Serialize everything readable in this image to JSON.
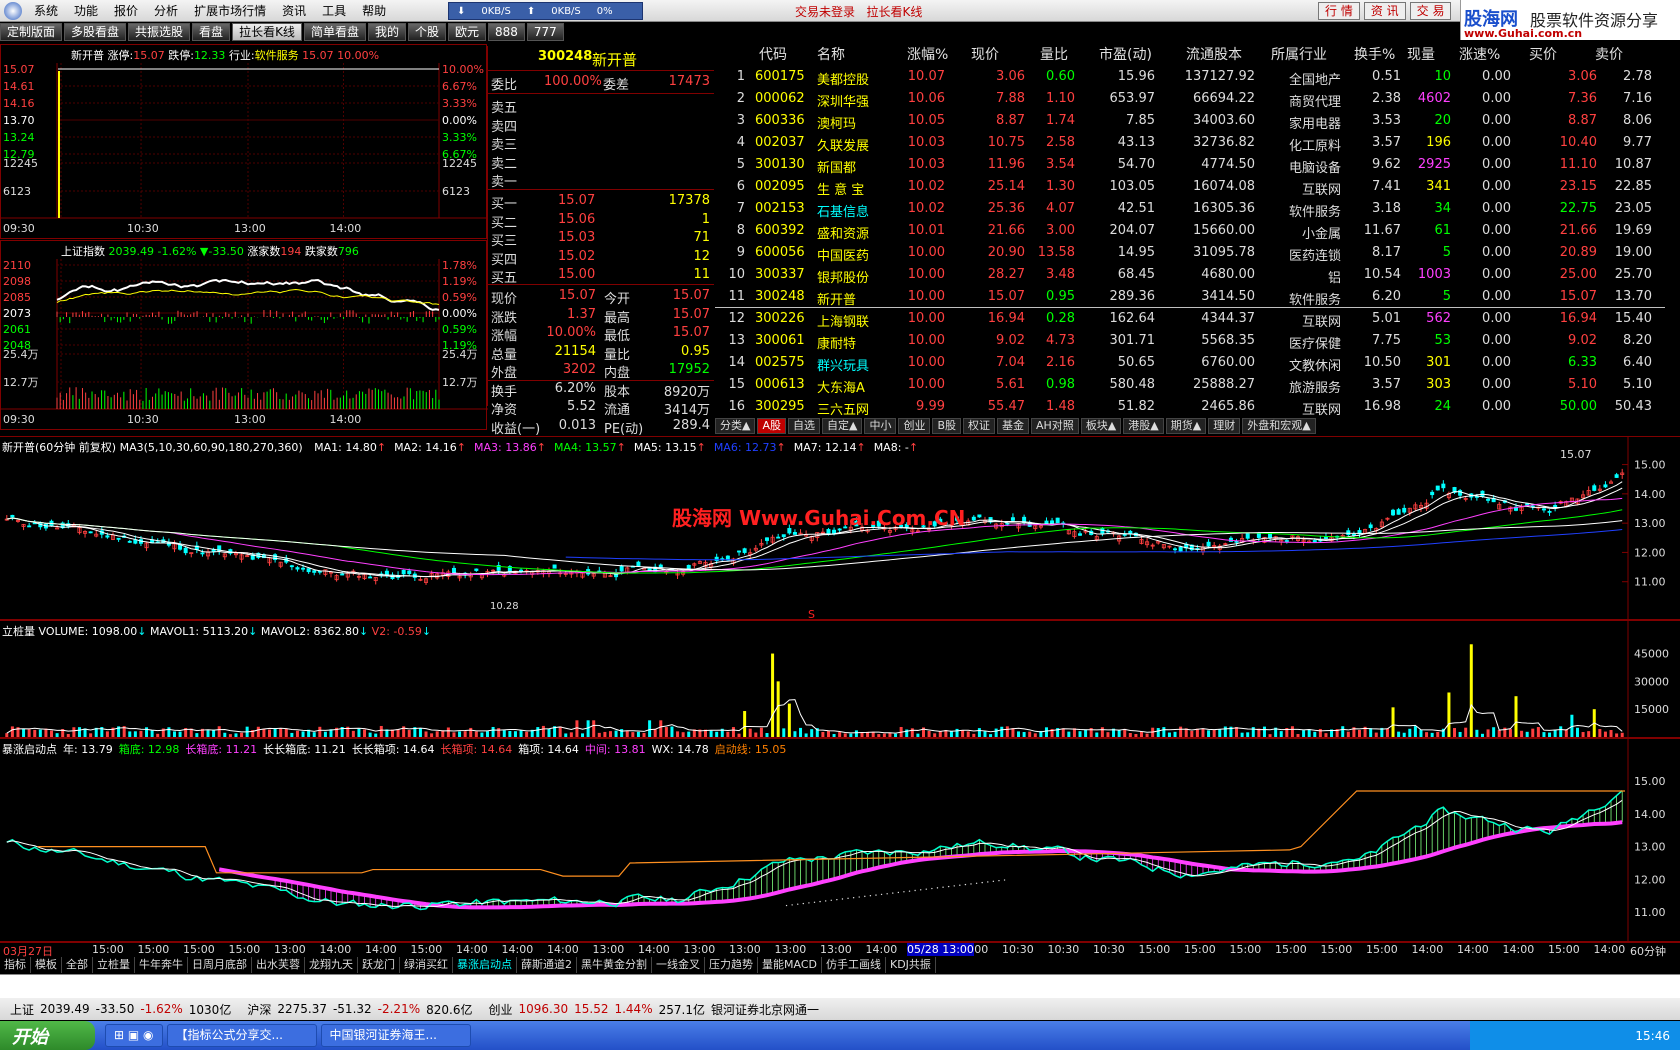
{
  "menu": [
    "系统",
    "功能",
    "报价",
    "分析",
    "扩展市场行情",
    "资讯",
    "工具",
    "帮助"
  ],
  "net": {
    "down": "0KB/S",
    "up": "0KB/S",
    "pct": "0%"
  },
  "login": "交易未登录",
  "login2": "拉长看K线",
  "topbtns": [
    "行 情",
    "资 讯",
    "交 易"
  ],
  "brand": {
    "name": "股海网",
    "slogan": "股票软件资源分享",
    "url": "www.Guhai.com.cn"
  },
  "tabs": [
    "定制版面",
    "多股看盘",
    "共振选股",
    "看盘",
    "拉长看K线",
    "简单看盘",
    "我的",
    "个股",
    "欧元",
    "888",
    "777"
  ],
  "mini1": {
    "title": "新开普",
    "zt_label": "涨停:",
    "zt": "15.07",
    "dt_label": "跌停:",
    "dt": "12.33",
    "ind_label": "行业:",
    "ind": "软件服务",
    "price": "15.07",
    "pct": "10.00%",
    "left_ticks": [
      "15.07",
      "14.61",
      "14.16",
      "13.70",
      "13.24",
      "12.79",
      "12245",
      "6123"
    ],
    "right_ticks": [
      "10.00%",
      "6.67%",
      "3.33%",
      "0.00%",
      "3.33%",
      "6.67%",
      "12245",
      "6123"
    ],
    "times": [
      "09:30",
      "10:30",
      "13:00",
      "14:00"
    ]
  },
  "mini2": {
    "title": "上证指数",
    "value": "2039.49",
    "pct": "-1.62%",
    "chg": "▼-33.50",
    "up_label": "涨家数",
    "up": "194",
    "down_label": "跌家数",
    "down": "796",
    "left_ticks": [
      "2110",
      "2098",
      "2085",
      "2073",
      "2061",
      "2048",
      "25.4万",
      "12.7万"
    ],
    "right_ticks": [
      "1.78%",
      "1.19%",
      "0.59%",
      "0.00%",
      "0.59%",
      "1.19%",
      "25.4万",
      "12.7万"
    ],
    "times": [
      "09:30",
      "10:30",
      "13:00",
      "14:00"
    ]
  },
  "book": {
    "code": "300248",
    "name": "新开普",
    "wb_label": "委比",
    "wb": "100.00%",
    "wc_label": "委差",
    "wc": "17473",
    "sells": [
      "卖五",
      "卖四",
      "卖三",
      "卖二",
      "卖一"
    ],
    "buys": [
      {
        "l": "买一",
        "p": "15.07",
        "v": "17378"
      },
      {
        "l": "买二",
        "p": "15.06",
        "v": "1"
      },
      {
        "l": "买三",
        "p": "15.03",
        "v": "71"
      },
      {
        "l": "买四",
        "p": "15.02",
        "v": "12"
      },
      {
        "l": "买五",
        "p": "15.00",
        "v": "11"
      }
    ],
    "stats": [
      [
        "现价",
        "15.07",
        "今开",
        "15.07"
      ],
      [
        "涨跌",
        "1.37",
        "最高",
        "15.07"
      ],
      [
        "涨幅",
        "10.00%",
        "最低",
        "15.07"
      ],
      [
        "总量",
        "21154",
        "量比",
        "0.95"
      ],
      [
        "外盘",
        "3202",
        "内盘",
        "17952"
      ],
      [
        "换手",
        "6.20%",
        "股本",
        "8920万"
      ],
      [
        "净资",
        "5.52",
        "流通",
        "3414万"
      ],
      [
        "收益(一)",
        "0.013",
        "PE(动)",
        "289.4"
      ]
    ]
  },
  "table": {
    "headers": [
      "代码",
      "名称",
      "涨幅%",
      "现价",
      "量比",
      "市盈(动)",
      "流通股本",
      "所属行业",
      "换手%",
      "现量",
      "涨速%",
      "买价",
      "卖价"
    ],
    "rows": [
      [
        "1",
        "600175",
        "美都控股",
        "10.07",
        "3.06",
        "0.60",
        "15.96",
        "137127.92",
        "全国地产",
        "0.51",
        "10",
        "0.00",
        "3.06",
        "2.78"
      ],
      [
        "2",
        "000062",
        "深圳华强",
        "10.06",
        "7.88",
        "1.10",
        "653.97",
        "66694.22",
        "商贸代理",
        "2.38",
        "4602",
        "0.00",
        "7.36",
        "7.16"
      ],
      [
        "3",
        "600336",
        "澳柯玛",
        "10.05",
        "8.87",
        "1.74",
        "7.85",
        "34003.60",
        "家用电器",
        "3.53",
        "20",
        "0.00",
        "8.87",
        "8.06"
      ],
      [
        "4",
        "002037",
        "久联发展",
        "10.03",
        "10.75",
        "2.58",
        "43.13",
        "32736.82",
        "化工原料",
        "3.57",
        "196",
        "0.00",
        "10.40",
        "9.77"
      ],
      [
        "5",
        "300130",
        "新国都",
        "10.03",
        "11.96",
        "3.54",
        "54.70",
        "4774.50",
        "电脑设备",
        "9.62",
        "2925",
        "0.00",
        "11.10",
        "10.87"
      ],
      [
        "6",
        "002095",
        "生 意 宝",
        "10.02",
        "25.14",
        "1.30",
        "103.05",
        "16074.08",
        "互联网",
        "7.41",
        "341",
        "0.00",
        "23.15",
        "22.85"
      ],
      [
        "7",
        "002153",
        "石基信息",
        "10.02",
        "25.36",
        "4.07",
        "42.51",
        "16305.36",
        "软件服务",
        "3.18",
        "34",
        "0.00",
        "22.75",
        "23.05"
      ],
      [
        "8",
        "600392",
        "盛和资源",
        "10.01",
        "21.66",
        "3.00",
        "204.07",
        "15660.00",
        "小金属",
        "11.67",
        "61",
        "0.00",
        "21.66",
        "19.69"
      ],
      [
        "9",
        "600056",
        "中国医药",
        "10.00",
        "20.90",
        "13.58",
        "14.95",
        "31095.78",
        "医药连锁",
        "8.17",
        "5",
        "0.00",
        "20.89",
        "19.00"
      ],
      [
        "10",
        "300337",
        "银邦股份",
        "10.00",
        "28.27",
        "3.48",
        "68.45",
        "4680.00",
        "铝",
        "10.54",
        "1003",
        "0.00",
        "25.00",
        "25.70"
      ],
      [
        "11",
        "300248",
        "新开普",
        "10.00",
        "15.07",
        "0.95",
        "289.36",
        "3414.50",
        "软件服务",
        "6.20",
        "5",
        "0.00",
        "15.07",
        "13.70"
      ],
      [
        "12",
        "300226",
        "上海钢联",
        "10.00",
        "16.94",
        "0.28",
        "162.64",
        "4344.37",
        "互联网",
        "5.01",
        "562",
        "0.00",
        "16.94",
        "15.40"
      ],
      [
        "13",
        "300061",
        "康耐特",
        "10.00",
        "9.02",
        "4.73",
        "301.71",
        "5568.35",
        "医疗保健",
        "7.75",
        "53",
        "0.00",
        "9.02",
        "8.20"
      ],
      [
        "14",
        "002575",
        "群兴玩具",
        "10.00",
        "7.04",
        "2.16",
        "50.65",
        "6760.00",
        "文教休闲",
        "10.50",
        "301",
        "0.00",
        "6.33",
        "6.40"
      ],
      [
        "15",
        "000613",
        "大东海A",
        "10.00",
        "5.61",
        "0.98",
        "580.48",
        "25888.27",
        "旅游服务",
        "3.57",
        "303",
        "0.00",
        "5.10",
        "5.10"
      ],
      [
        "16",
        "300295",
        "三六五网",
        "9.99",
        "55.47",
        "1.48",
        "51.82",
        "2465.86",
        "互联网",
        "16.98",
        "24",
        "0.00",
        "50.00",
        "50.43"
      ]
    ]
  },
  "market_tabs": [
    "分类▲",
    "A股",
    "自选",
    "自定▲",
    "中小",
    "创业",
    "B股",
    "权证",
    "基金",
    "AH对照",
    "板块▲",
    "港股▲",
    "期货▲",
    "理财",
    "外盘和宏观▲"
  ],
  "kline": {
    "title": "新开普(60分钟 前复权)",
    "ma_label": "MA3(5,10,30,60,90,180,270,360)",
    "mas": [
      {
        "t": "MA1: 14.80",
        "c": "#ffffff"
      },
      {
        "t": "MA2: 14.16",
        "c": "#ffffff"
      },
      {
        "t": "MA3: 13.86",
        "c": "#ff40ff"
      },
      {
        "t": "MA4: 13.57",
        "c": "#00ff00"
      },
      {
        "t": "MA5: 13.15",
        "c": "#ffffff"
      },
      {
        "t": "MA6: 12.73",
        "c": "#2040ff"
      },
      {
        "t": "MA7: 12.14",
        "c": "#ffffff"
      },
      {
        "t": "MA8: -",
        "c": "#ffffff"
      }
    ],
    "ticks": [
      "15.00",
      "14.00",
      "13.00",
      "12.00",
      "11.00"
    ],
    "last": "15.07",
    "low": "10.28",
    "watermark": "股海网 Www.Guhai.Com.CN",
    "marker": "S"
  },
  "vol": {
    "title": "立桩量",
    "v": "VOLUME: 1098.00",
    "m1": "MAVOL1: 5113.20",
    "m2": "MAVOL2: 8362.80",
    "v2": "V2: -0.59",
    "ticks": [
      "45000",
      "30000",
      "15000"
    ]
  },
  "ind": {
    "title": "暴涨启动点",
    "items": [
      {
        "t": "年: 13.79",
        "c": "#ffffff"
      },
      {
        "t": "箱底: 12.98",
        "c": "#00ff00"
      },
      {
        "t": "长箱底: 11.21",
        "c": "#ff40ff"
      },
      {
        "t": "长长箱底: 11.21",
        "c": "#ffffff"
      },
      {
        "t": "长长箱项: 14.64",
        "c": "#ffffff"
      },
      {
        "t": "长箱项: 14.64",
        "c": "#ff4040"
      },
      {
        "t": "箱项: 14.64",
        "c": "#ffffff"
      },
      {
        "t": "中间: 13.81",
        "c": "#ff40ff"
      },
      {
        "t": "WX: 14.78",
        "c": "#ffffff"
      },
      {
        "t": "启动线: 15.05",
        "c": "#ff8000"
      }
    ],
    "ticks": [
      "15.00",
      "14.00",
      "13.00",
      "12.00",
      "11.00"
    ]
  },
  "xaxis": {
    "start": "03月27日",
    "labels": [
      "15:00",
      "15:00",
      "15:00",
      "15:00",
      "13:00",
      "14:00",
      "14:00",
      "15:00",
      "14:00",
      "14:00",
      "14:00",
      "13:00",
      "14:00",
      "13:00",
      "13:00",
      "13:00",
      "13:00",
      "14:00",
      "10:30",
      "13:00",
      "10:30",
      "10:30",
      "10:30",
      "15:00",
      "15:00",
      "15:00",
      "15:00",
      "15:00",
      "15:00",
      "14:00",
      "14:00",
      "14:00",
      "15:00",
      "14:00"
    ],
    "cursor": "05/28 13:00",
    "period": "60分钟"
  },
  "bottom_tabs": [
    "指标",
    "模板",
    "全部",
    "立桩量",
    "牛年奔牛",
    "日周月底部",
    "出水芙蓉",
    "龙翔九天",
    "跃龙门",
    "绿消买红",
    "暴涨启动点",
    "薛斯通道2",
    "黑牛黄金分割",
    "一线金叉",
    "压力趋势",
    "量能MACD",
    "仿手工画线",
    "KDJ共振"
  ],
  "status": [
    {
      "t": "上证",
      "c": "#000"
    },
    {
      "t": "2039.49",
      "c": "#000"
    },
    {
      "t": "-33.50",
      "c": "#000"
    },
    {
      "t": "-1.62%",
      "c": "#c00000"
    },
    {
      "t": "1030亿",
      "c": "#000"
    },
    {
      "t": "沪深",
      "c": "#000"
    },
    {
      "t": "2275.37",
      "c": "#000"
    },
    {
      "t": "-51.32",
      "c": "#000"
    },
    {
      "t": "-2.21%",
      "c": "#c00000"
    },
    {
      "t": "820.6亿",
      "c": "#000"
    },
    {
      "t": "创业",
      "c": "#000"
    },
    {
      "t": "1096.30",
      "c": "#c00000"
    },
    {
      "t": "15.52",
      "c": "#c00000"
    },
    {
      "t": "1.44%",
      "c": "#c00000"
    },
    {
      "t": "257.1亿",
      "c": "#000"
    },
    {
      "t": "银河证券北京网通一",
      "c": "#000"
    }
  ],
  "taskbar": {
    "start": "开始",
    "tasks": [
      "【指标公式分享交...",
      "中国银河证券海王..."
    ],
    "clock": "15:46"
  }
}
